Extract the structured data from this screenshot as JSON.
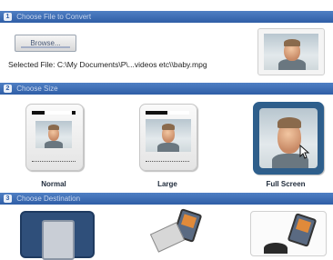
{
  "sections": [
    {
      "number": "1",
      "title": "Choose File to Convert"
    },
    {
      "number": "2",
      "title": "Choose Size"
    },
    {
      "number": "3",
      "title": "Choose Destination"
    }
  ],
  "file": {
    "browse_label": "Browse...",
    "selected_text": "Selected File: C:\\My Documents\\P\\...videos etc\\\\baby.mpg"
  },
  "sizes": [
    {
      "label": "Normal"
    },
    {
      "label": "Large"
    },
    {
      "label": "Full Screen",
      "selected": true
    }
  ],
  "colors": {
    "section_bar": "#3a69b1",
    "selected_border": "#2d5f8d"
  }
}
